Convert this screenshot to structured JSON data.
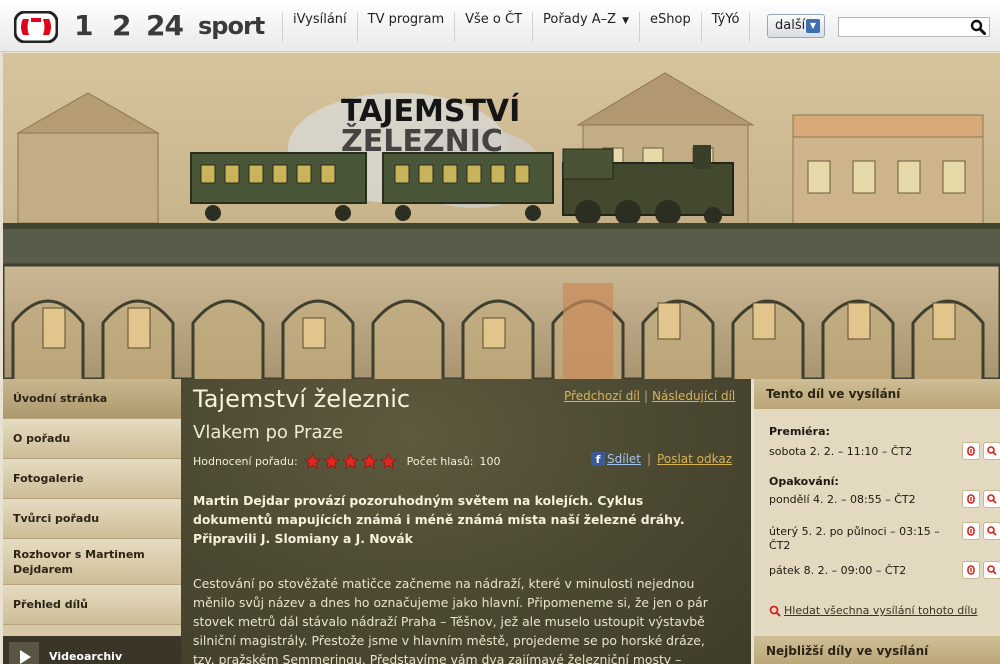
{
  "header": {
    "channels": [
      "1",
      "2",
      "24",
      "sport"
    ],
    "nav": [
      {
        "label": "iVysílání"
      },
      {
        "label": "TV program"
      },
      {
        "label": "Vše o ČT"
      },
      {
        "label": "Pořady A–Z",
        "dropdown": true
      },
      {
        "label": "eShop"
      },
      {
        "label": "TýYó"
      }
    ],
    "more_label": "další",
    "search_placeholder": "",
    "search_icon": "magnifier-icon",
    "brand_color": "#e2001a"
  },
  "banner": {
    "title_line1": "TAJEMSTVÍ",
    "title_line2": "ŽELEZNIC"
  },
  "sidebar": {
    "items": [
      {
        "label": "Úvodní stránka",
        "active": true
      },
      {
        "label": "O pořadu"
      },
      {
        "label": "Fotogalerie"
      },
      {
        "label": "Tvůrci pořadu"
      },
      {
        "label": "Rozhovor s Martinem Dejdarem"
      },
      {
        "label": "Přehled dílů"
      },
      {
        "label": "Videoarchiv",
        "icon": "play-icon"
      }
    ]
  },
  "main": {
    "title": "Tajemství železnic",
    "prev_label": "Předchozí díl",
    "next_label": "Následující díl",
    "subtitle": "Vlakem po Praze",
    "rating_label": "Hodnocení pořadu:",
    "rating_stars": 5,
    "votes_label": "Počet hlasů:",
    "votes_count": "100",
    "share_label": "Sdílet",
    "send_link_label": "Poslat odkaz",
    "lead": "Martin Dejdar provází pozoruhodným světem na kolejích. Cyklus dokumentů mapujících známá i méně známá místa naší železné dráhy. Připravili J. Slomiany a J. Novák",
    "body": "Cestování po stověžaté matičce začneme na nádraží, které v minulosti nejednou měnilo svůj název a dnes ho označujeme jako hlavní. Připomeneme si, že jen o pár stovek metrů dál stávalo nádraží Praha – Těšnov, jež ale muselo ustoupit výstavbě silniční magistrály. Přestože jsme v hlavním městě, projedeme se po horské dráze, tzv. pražském Semmeringu. Představíme vám dva zajímavé železniční mosty – Negrelliho viadukt a „Most"
  },
  "broadcast": {
    "heading": "Tento díl ve vysílání",
    "premiere_label": "Premiéra:",
    "premiere": "sobota 2. 2. – 11:10 – ČT2",
    "repeats_label": "Opakování:",
    "repeats": [
      "pondělí 4. 2. – 08:55 – ČT2",
      "úterý 5. 2. po půlnoci – 03:15 – ČT2",
      "pátek 8. 2. – 09:00 – ČT2"
    ],
    "all_link": "Hledat všechna vysílání tohoto dílu",
    "next_heading": "Nejbližší díly ve vysílání"
  }
}
